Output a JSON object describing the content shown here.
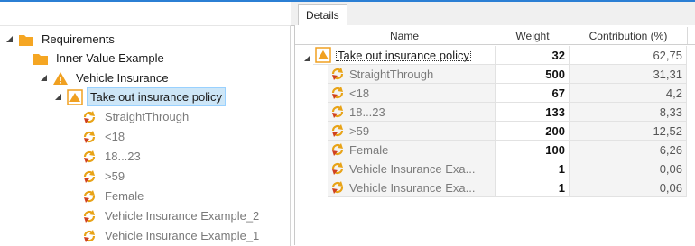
{
  "colors": {
    "accent": "#2b7fd4",
    "folder": "#f5a623",
    "warning": "#f0a020",
    "selection": "#cde6f7",
    "refresh_icon": "#e8a317"
  },
  "tree": {
    "nodes": [
      {
        "label": "Requirements",
        "icon": "folder-icon",
        "expander": "expanded-triangle"
      },
      {
        "label": "Inner Value Example",
        "icon": "folder-icon",
        "expander": "none"
      },
      {
        "label": "Vehicle Insurance",
        "icon": "warning-triangle-icon",
        "expander": "expanded-triangle"
      },
      {
        "label": "Take out insurance policy",
        "icon": "warning-box-icon",
        "expander": "expanded-triangle",
        "selected": true
      },
      {
        "label": "StraightThrough",
        "icon": "refresh-icon",
        "muted": true
      },
      {
        "label": "<18",
        "icon": "refresh-icon"
      },
      {
        "label": "18...23",
        "icon": "refresh-icon"
      },
      {
        "label": ">59",
        "icon": "refresh-icon"
      },
      {
        "label": "Female",
        "icon": "refresh-icon"
      },
      {
        "label": "Vehicle Insurance Example_2",
        "icon": "refresh-icon"
      },
      {
        "label": "Vehicle Insurance Example_1",
        "icon": "refresh-icon"
      }
    ]
  },
  "details": {
    "tab_label": "Details",
    "columns": {
      "name": "Name",
      "weight": "Weight",
      "contribution": "Contribution (%)"
    },
    "rows": [
      {
        "name": "Take out insurance policy",
        "weight": "32",
        "contribution": "62,75",
        "icon": "warning-box-icon",
        "parent": true
      },
      {
        "name": "StraightThrough",
        "weight": "500",
        "contribution": "31,31",
        "icon": "refresh-icon"
      },
      {
        "name": "<18",
        "weight": "67",
        "contribution": "4,2",
        "icon": "refresh-icon"
      },
      {
        "name": "18...23",
        "weight": "133",
        "contribution": "8,33",
        "icon": "refresh-icon"
      },
      {
        "name": ">59",
        "weight": "200",
        "contribution": "12,52",
        "icon": "refresh-icon"
      },
      {
        "name": "Female",
        "weight": "100",
        "contribution": "6,26",
        "icon": "refresh-icon"
      },
      {
        "name": "Vehicle Insurance Exa...",
        "weight": "1",
        "contribution": "0,06",
        "icon": "refresh-icon"
      },
      {
        "name": "Vehicle Insurance Exa...",
        "weight": "1",
        "contribution": "0,06",
        "icon": "refresh-icon"
      }
    ]
  }
}
